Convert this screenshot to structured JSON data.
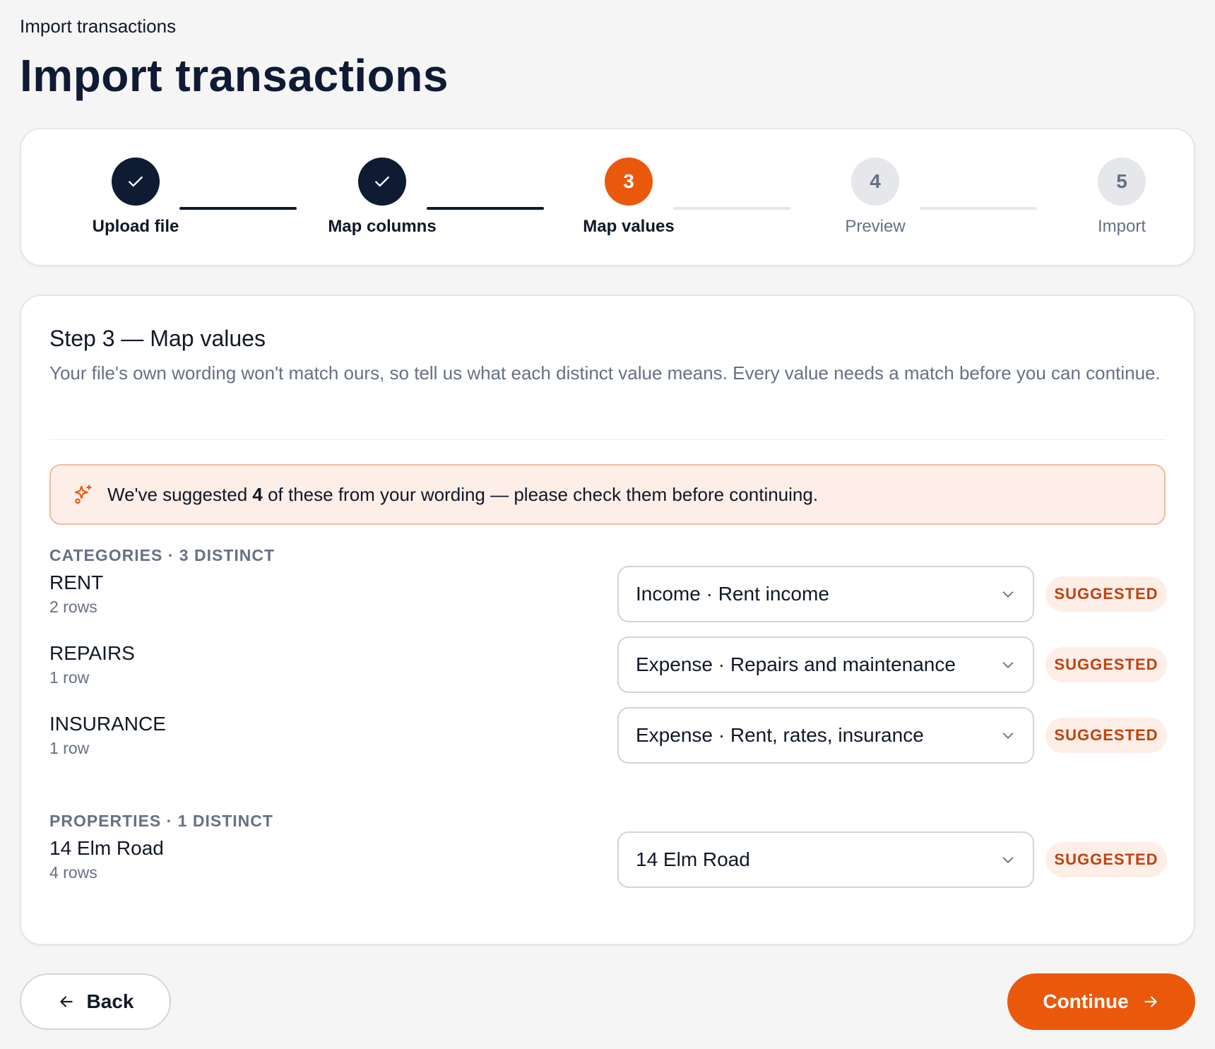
{
  "breadcrumb": "Import transactions",
  "page_title": "Import transactions",
  "stepper": {
    "steps": [
      {
        "number": "1",
        "label": "Upload file",
        "state": "done"
      },
      {
        "number": "2",
        "label": "Map columns",
        "state": "done"
      },
      {
        "number": "3",
        "label": "Map values",
        "state": "active"
      },
      {
        "number": "4",
        "label": "Preview",
        "state": "pending"
      },
      {
        "number": "5",
        "label": "Import",
        "state": "pending"
      }
    ]
  },
  "card": {
    "title": "Step 3 — Map values",
    "description": "Your file's own wording won't match ours, so tell us what each distinct value means. Every value needs a match before you can continue."
  },
  "notice": {
    "prefix": "We've suggested ",
    "count": "4",
    "suffix": " of these from your wording — please check them before continuing.",
    "icon": "sparkle-icon"
  },
  "categories": {
    "label": "CATEGORIES · 3 DISTINCT",
    "rows": [
      {
        "name": "RENT",
        "count": "2 rows",
        "mapped": "Income · Rent income",
        "badge": "SUGGESTED"
      },
      {
        "name": "REPAIRS",
        "count": "1 row",
        "mapped": "Expense · Repairs and maintenance",
        "badge": "SUGGESTED"
      },
      {
        "name": "INSURANCE",
        "count": "1 row",
        "mapped": "Expense · Rent, rates, insurance",
        "badge": "SUGGESTED"
      }
    ]
  },
  "properties": {
    "label": "PROPERTIES · 1 DISTINCT",
    "rows": [
      {
        "name": "14 Elm Road",
        "count": "4 rows",
        "mapped": "14 Elm Road",
        "badge": "SUGGESTED"
      }
    ]
  },
  "footer": {
    "back_label": "Back",
    "continue_label": "Continue"
  },
  "colors": {
    "accent": "#ea580c",
    "navy": "#0f1a33",
    "badge_bg": "#fdeee8",
    "badge_text": "#c2410c"
  }
}
